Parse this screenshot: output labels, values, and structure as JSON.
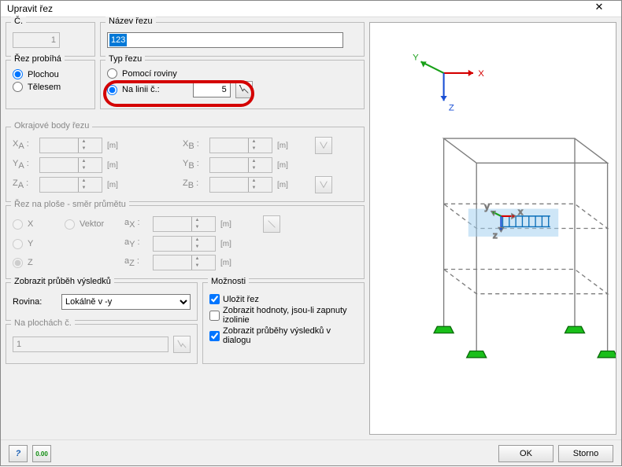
{
  "window": {
    "title": "Upravit řez"
  },
  "sec_number": {
    "legend": "Č.",
    "value": "1"
  },
  "sec_name": {
    "legend": "Název řezu",
    "value": "123"
  },
  "sec_runs": {
    "legend": "Řez probíhá",
    "opt_plane": "Plochou",
    "opt_solid": "Tělesem",
    "selected": "plane"
  },
  "sec_type": {
    "legend": "Typ řezu",
    "opt_by_plane": "Pomocí roviny",
    "opt_on_line": "Na linii č.:",
    "line_no": "5"
  },
  "boundary": {
    "legend": "Okrajové body řezu",
    "xa": "XA :",
    "ya": "YA :",
    "za": "ZA :",
    "xb": "XB :",
    "yb": "YB :",
    "zb": "ZB :",
    "unit": "[m]"
  },
  "projection": {
    "legend": "Řez na ploše - směr průmětu",
    "x": "X",
    "y": "Y",
    "z": "Z",
    "vector": "Vektor",
    "ax": "aX :",
    "ay": "aY :",
    "az": "aZ :",
    "unit": "[m]"
  },
  "results": {
    "legend": "Zobrazit průběh výsledků",
    "plane_label": "Rovina:",
    "plane_value": "Lokálně v -y"
  },
  "options": {
    "legend": "Možnosti",
    "save": "Uložit řez",
    "show_values": "Zobrazit hodnoty, jsou-li zapnuty izolinie",
    "show_results": "Zobrazit průběhy výsledků v dialogu"
  },
  "surfaces": {
    "legend": "Na plochách č.",
    "value": "1"
  },
  "footer": {
    "ok": "OK",
    "cancel": "Storno"
  },
  "axes": {
    "x": "X",
    "y": "Y",
    "z": "Z"
  },
  "local_axes": {
    "x": "x",
    "y": "y",
    "z": "z"
  }
}
